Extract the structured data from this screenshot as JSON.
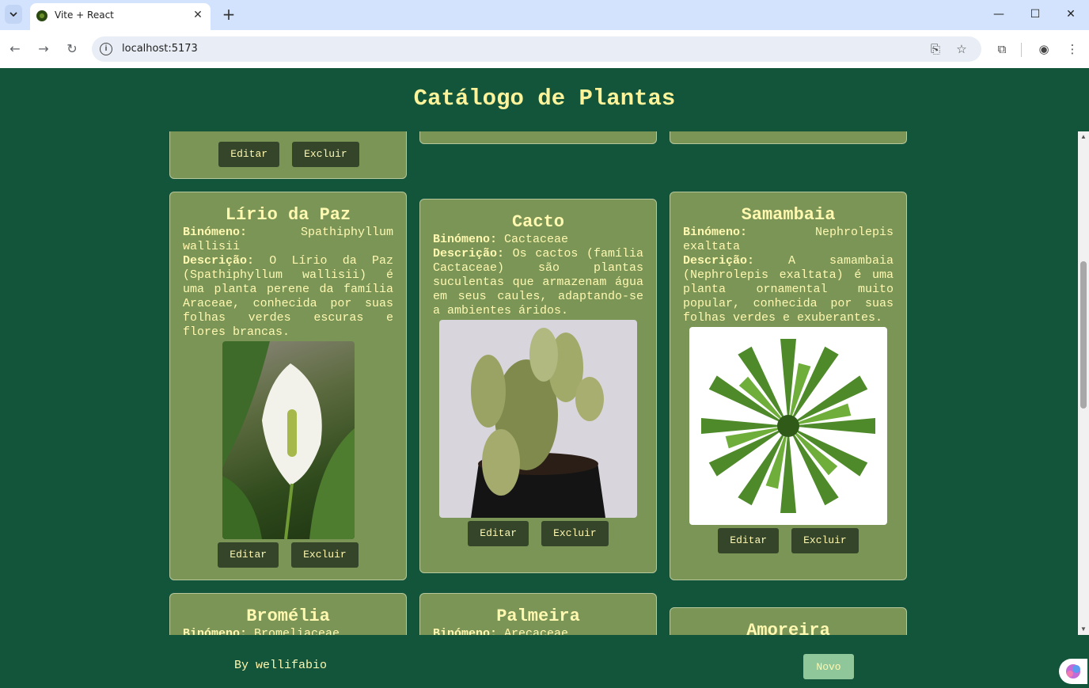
{
  "browser": {
    "tab_title": "Vite + React",
    "tab_close": "✕",
    "new_tab": "+",
    "url": "localhost:5173",
    "window": {
      "minimize": "—",
      "maximize": "☐",
      "close": "✕"
    }
  },
  "page": {
    "title": "Catálogo de Plantas"
  },
  "labels": {
    "binomial": "Binómeno:",
    "description": "Descrição:",
    "edit": "Editar",
    "delete": "Excluir"
  },
  "cards": [
    {
      "name": "Lírio da Paz",
      "binomial": "Spathiphyllum wallisii",
      "description": "O Lírio da Paz (Spathiphyllum wallisii) é uma planta perene da família Araceae, conhecida por suas folhas verdes escuras e flores brancas."
    },
    {
      "name": "Cacto",
      "binomial": "Cactaceae",
      "description": "Os cactos (família Cactaceae) são plantas suculentas que armazenam água em seus caules, adaptando-se a ambientes áridos."
    },
    {
      "name": "Samambaia",
      "binomial": "Nephrolepis exaltata",
      "description": "A samambaia (Nephrolepis exaltata) é uma planta ornamental muito popular, conhecida por suas folhas verdes e exuberantes."
    },
    {
      "name": "Bromélia",
      "binomial": "Bromeliaceae"
    },
    {
      "name": "Palmeira",
      "binomial": "Arecaceae"
    },
    {
      "name": "Amoreira"
    }
  ],
  "footer": {
    "by": "By wellifabio",
    "new_label": "Novo"
  },
  "colors": {
    "background": "#12553a",
    "card": "#7a9556",
    "text": "#fff8b0",
    "button": "#34452a",
    "new_button": "#8fc79b"
  }
}
